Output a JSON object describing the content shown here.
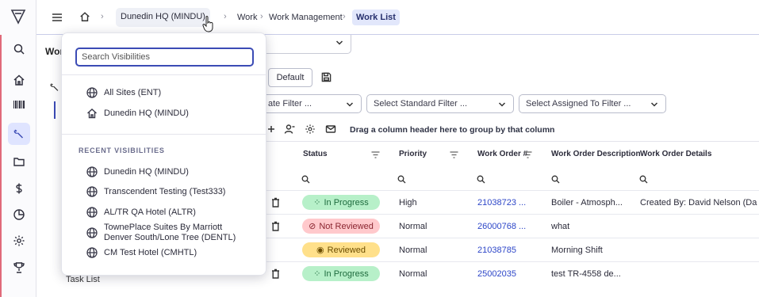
{
  "topbar": {
    "breadcrumbs": [
      "Dunedin HQ (MINDU)",
      "Work",
      "Work Management",
      "Work List"
    ],
    "separator": "›"
  },
  "page": {
    "title": "Wor",
    "sidebar_task_list": "Task List"
  },
  "toolbar": {
    "default_label": "Default",
    "filters": [
      {
        "label": "ate Filter ..."
      },
      {
        "label": "Select Standard Filter ..."
      },
      {
        "label": "Select Assigned To Filter ..."
      }
    ],
    "group_hint": "Drag a column header here to group by that column"
  },
  "grid": {
    "columns": [
      "Status",
      "Priority",
      "Work Order #",
      "Work Order Description",
      "Work Order Details"
    ],
    "rows": [
      {
        "status": "In Progress",
        "status_kind": "progress",
        "priority": "High",
        "wo": "21038723 ...",
        "description": "Boiler - Atmosph...",
        "details": "Created By: David Nelson (Da"
      },
      {
        "status": "Not Reviewed",
        "status_kind": "notrev",
        "priority": "Normal",
        "wo": "26000768 ...",
        "description": "what",
        "details": ""
      },
      {
        "status": "Reviewed",
        "status_kind": "reviewed",
        "priority": "Normal",
        "wo": "21038785",
        "description": "Morning Shift",
        "details": ""
      },
      {
        "status": "In Progress",
        "status_kind": "progress",
        "priority": "Normal",
        "wo": "25002035",
        "description": "test TR-4558 de...",
        "details": ""
      }
    ]
  },
  "popup": {
    "search_placeholder": "Search Visibilities",
    "top_items": [
      {
        "label": "All Sites (ENT)",
        "icon": "globe-icon"
      },
      {
        "label": "Dunedin HQ (MINDU)",
        "icon": "home-icon"
      }
    ],
    "recent_title": "RECENT VISIBILITIES",
    "recent_items": [
      {
        "label": "Dunedin HQ (MINDU)",
        "icon": "globe-icon"
      },
      {
        "label": "Transcendent Testing (Test333)",
        "icon": "globe-icon"
      },
      {
        "label": "AL/TR QA Hotel (ALTR)",
        "icon": "globe-icon"
      },
      {
        "label": "TownePlace Suites By Marriott Denver South/Lone Tree (DENTL)",
        "icon": "globe-icon"
      },
      {
        "label": "CM Test Hotel (CMHTL)",
        "icon": "globe-icon"
      }
    ]
  },
  "colors": {
    "accent": "#3b4bb5",
    "in_progress_bg": "#b7f0c9",
    "not_reviewed_bg": "#ffc9cc",
    "reviewed_bg": "#ffe08a",
    "link": "#2d46c8"
  }
}
